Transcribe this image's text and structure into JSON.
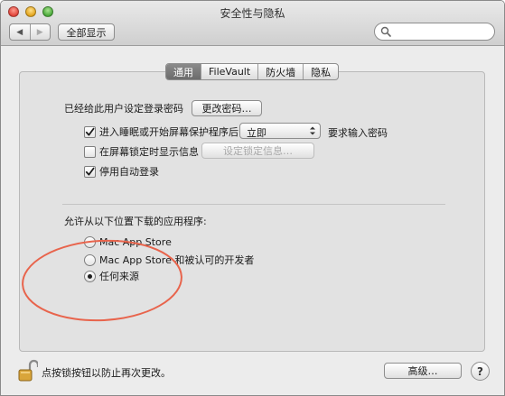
{
  "window": {
    "title": "安全性与隐私"
  },
  "toolbar": {
    "back_glyph": "◀",
    "forward_glyph": "▶",
    "show_all_label": "全部显示",
    "search_value": "",
    "search_placeholder": ""
  },
  "tabs": [
    {
      "label": "通用",
      "active": true
    },
    {
      "label": "FileVault",
      "active": false
    },
    {
      "label": "防火墙",
      "active": false
    },
    {
      "label": "隐私",
      "active": false
    }
  ],
  "general": {
    "login_password_text": "已经给此用户设定登录密码",
    "change_password_button": "更改密码…",
    "require_password": {
      "label": "进入睡眠或开始屏幕保护程序后",
      "checked": true
    },
    "require_delay_value": "立即",
    "require_suffix": "要求输入密码",
    "show_message": {
      "label": "在屏幕锁定时显示信息",
      "checked": false
    },
    "set_lock_message_button": "设定锁定信息…",
    "disable_auto_login": {
      "label": "停用自动登录",
      "checked": true
    }
  },
  "downloads": {
    "heading": "允许从以下位置下载的应用程序:",
    "options": [
      {
        "label": "Mac App Store",
        "selected": false
      },
      {
        "label": "Mac App Store 和被认可的开发者",
        "selected": false
      },
      {
        "label": "任何来源",
        "selected": true
      }
    ]
  },
  "footer": {
    "lock_text": "点按锁按钮以防止再次更改。",
    "advanced_button": "高级…",
    "help_glyph": "?"
  },
  "colors": {
    "annotation_ring": "#e8644c"
  }
}
